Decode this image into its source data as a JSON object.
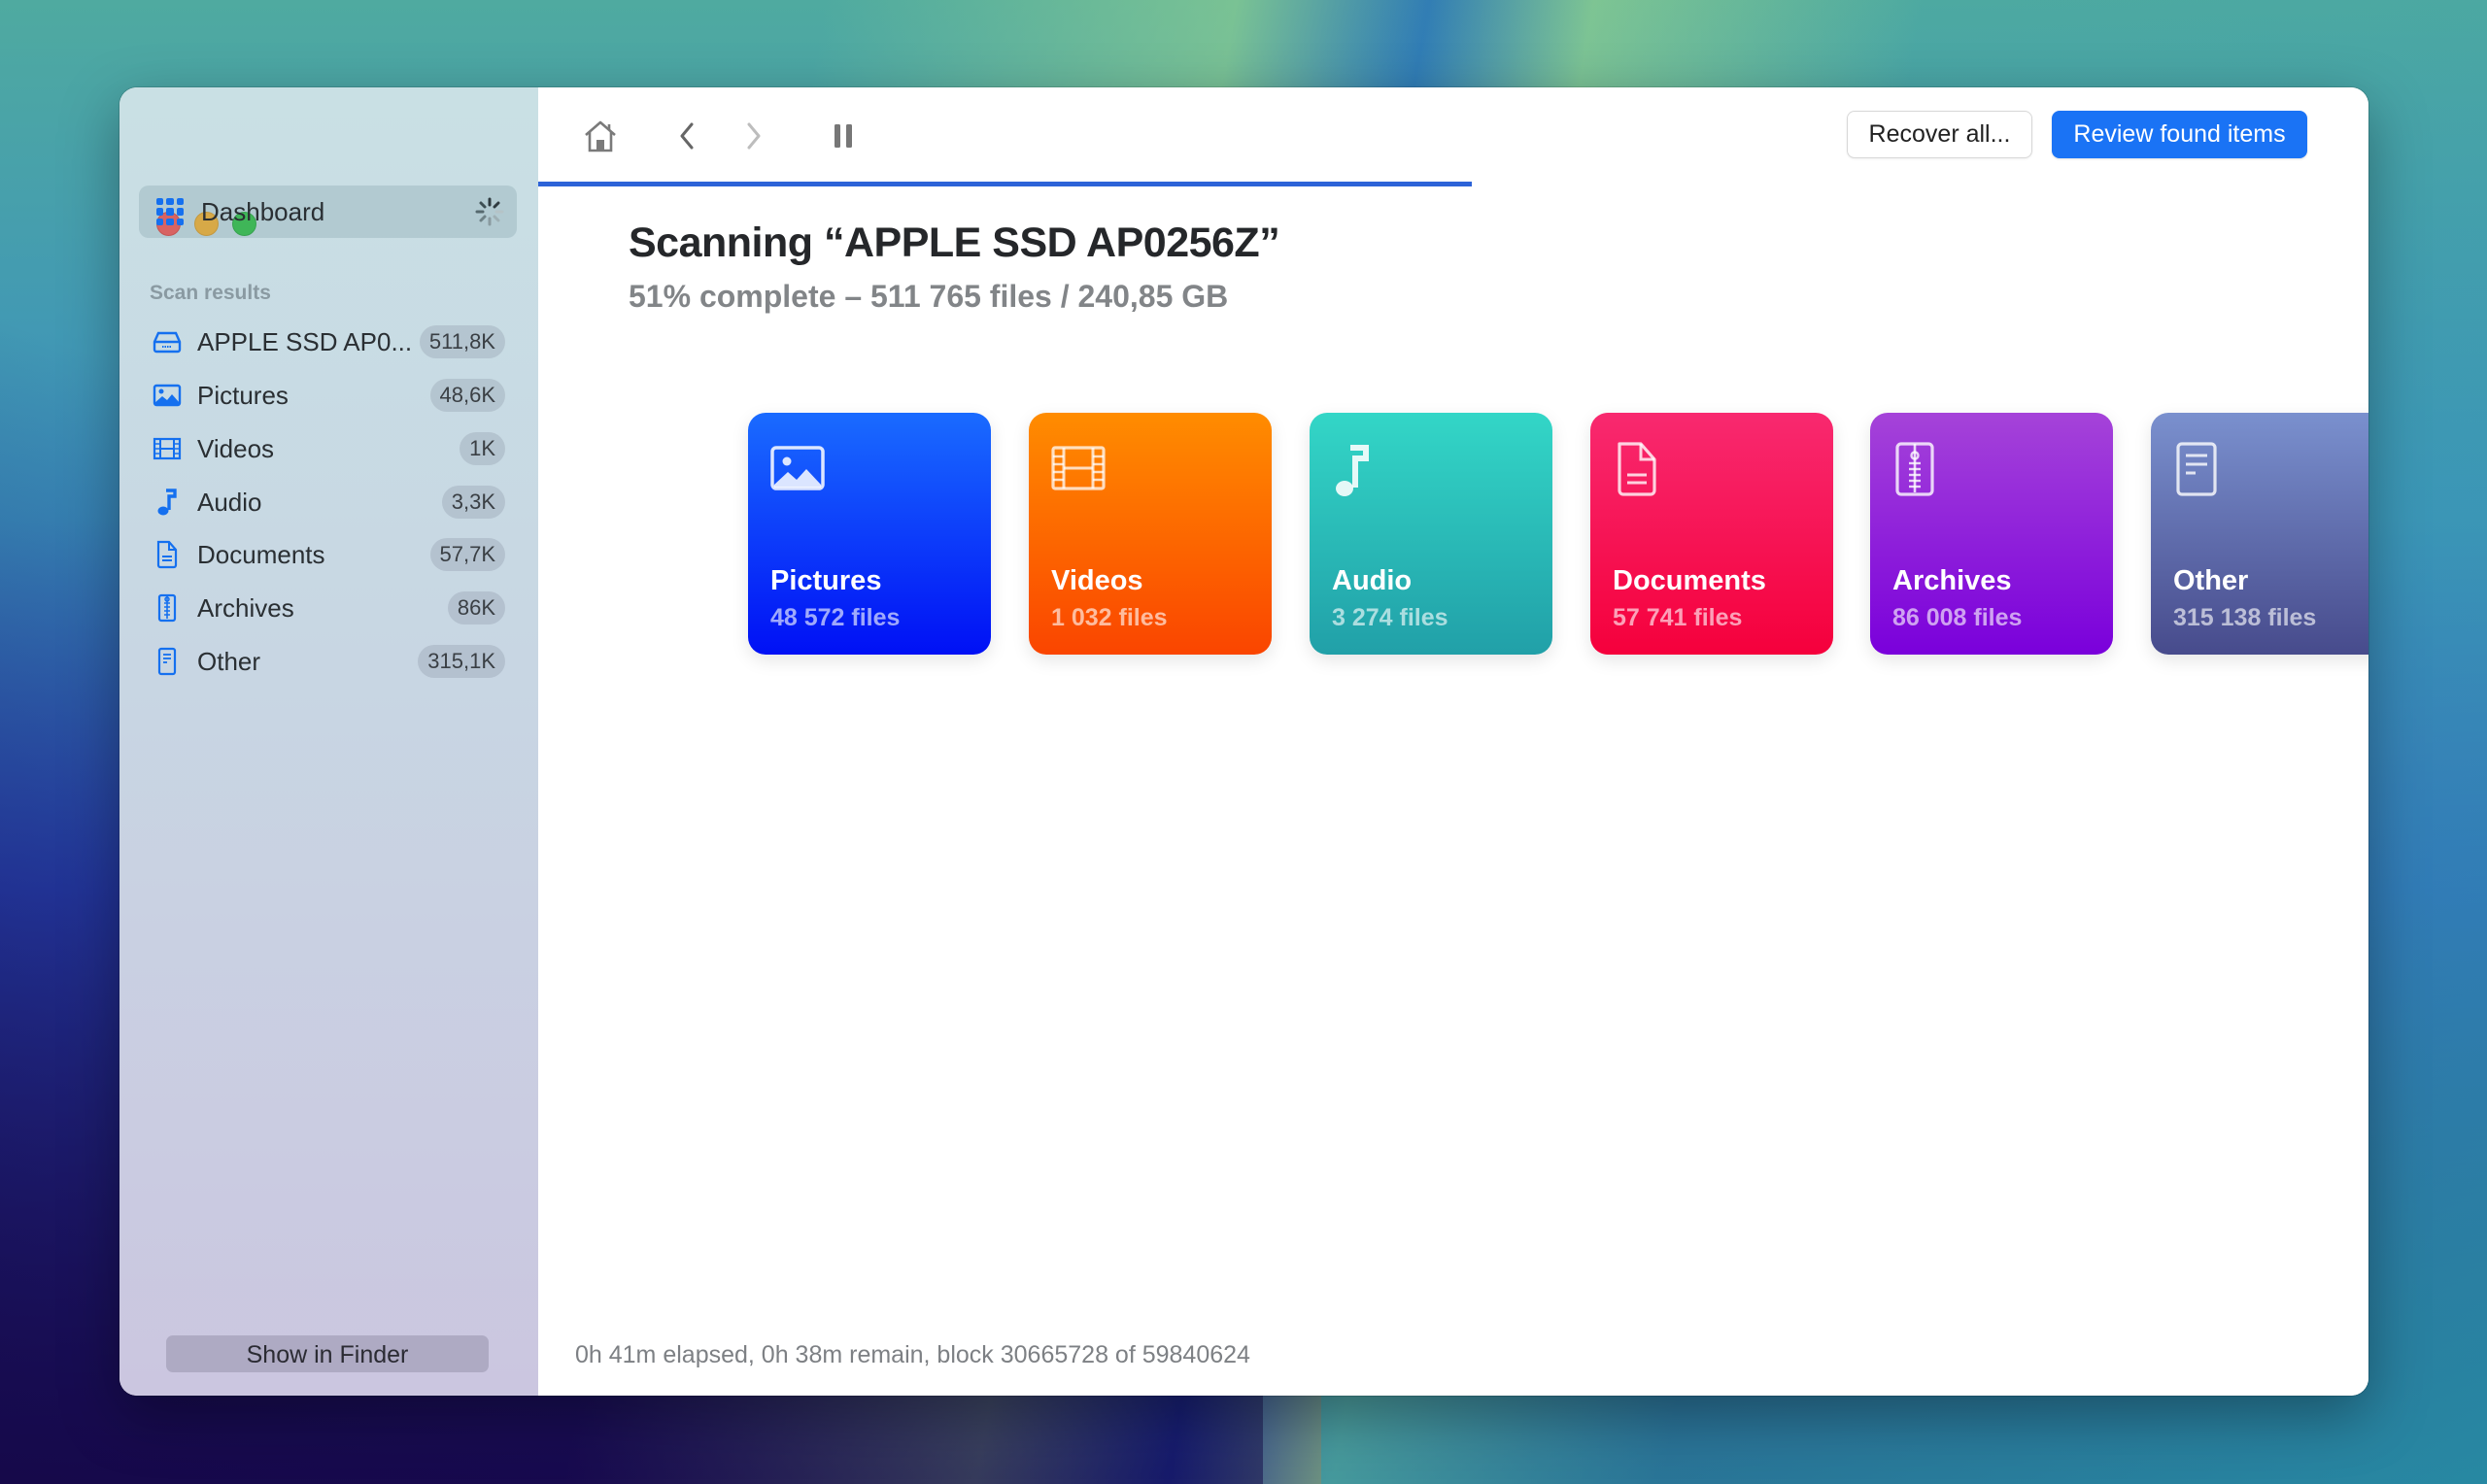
{
  "window": {
    "traffic_lights": [
      "close",
      "minimize",
      "maximize"
    ]
  },
  "sidebar": {
    "dashboard": {
      "label": "Dashboard",
      "icon": "grid-icon",
      "status_icon": "spinner-icon"
    },
    "section_label": "Scan results",
    "items": [
      {
        "label": "APPLE SSD AP0...",
        "badge": "511,8K",
        "icon": "drive-icon"
      },
      {
        "label": "Pictures",
        "badge": "48,6K",
        "icon": "photo-icon"
      },
      {
        "label": "Videos",
        "badge": "1K",
        "icon": "film-icon"
      },
      {
        "label": "Audio",
        "badge": "3,3K",
        "icon": "music-note-icon"
      },
      {
        "label": "Documents",
        "badge": "57,7K",
        "icon": "document-icon"
      },
      {
        "label": "Archives",
        "badge": "86K",
        "icon": "zip-archive-icon"
      },
      {
        "label": "Other",
        "badge": "315,1K",
        "icon": "text-file-icon"
      }
    ],
    "show_in_finder_label": "Show in Finder"
  },
  "toolbar": {
    "icons": [
      "home-icon",
      "back-icon",
      "forward-icon",
      "pause-icon"
    ],
    "recover_all_label": "Recover all...",
    "review_label": "Review found items",
    "accent_color": "#1a73f5"
  },
  "scan": {
    "title": "Scanning “APPLE SSD AP0256Z”",
    "subtitle": "51% complete – 511 765 files / 240,85 GB",
    "progress_percent": 51,
    "progress_color": "#2d63d8",
    "status": "0h 41m elapsed, 0h 38m remain, block 30665728 of 59840624"
  },
  "cards": [
    {
      "name": "Pictures",
      "count": "48 572 files",
      "icon": "photo-icon",
      "colors": [
        "#1a6bff",
        "#0010f5"
      ]
    },
    {
      "name": "Videos",
      "count": "1 032 files",
      "icon": "film-icon",
      "colors": [
        "#ff8c00",
        "#fa4500"
      ]
    },
    {
      "name": "Audio",
      "count": "3 274 files",
      "icon": "music-note-icon",
      "colors": [
        "#33d6c7",
        "#21a0a8"
      ]
    },
    {
      "name": "Documents",
      "count": "57 741 files",
      "icon": "document-icon",
      "colors": [
        "#f8296f",
        "#f5003c"
      ]
    },
    {
      "name": "Archives",
      "count": "86 008 files",
      "icon": "zip-archive-icon",
      "colors": [
        "#a543d9",
        "#7a00db"
      ]
    },
    {
      "name": "Other",
      "count": "315 138 files",
      "icon": "text-file-icon",
      "colors": [
        "#7a90ce",
        "#474b8c"
      ]
    }
  ]
}
